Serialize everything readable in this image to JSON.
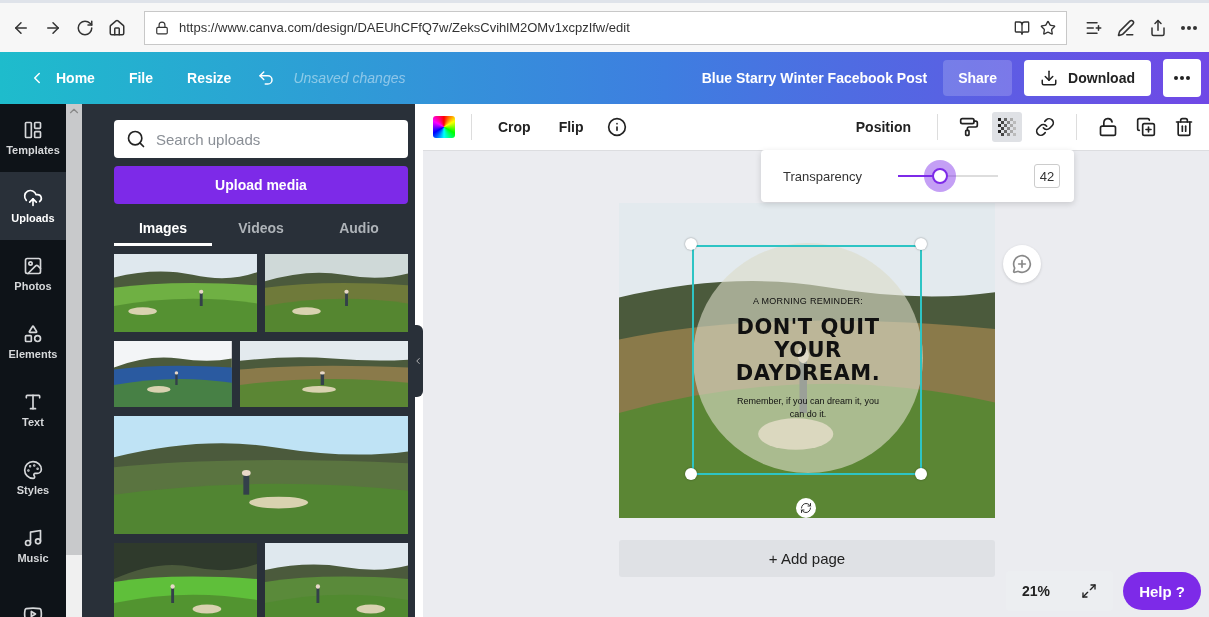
{
  "browser": {
    "url": "https://www.canva.com/design/DAEUhCFfQ7w/ZeksCvihlM2OMv1xcpzIfw/edit"
  },
  "topbar": {
    "home": "Home",
    "file": "File",
    "resize": "Resize",
    "status": "Unsaved changes",
    "title": "Blue Starry Winter Facebook Post",
    "share": "Share",
    "download": "Download"
  },
  "sidebar": {
    "items": [
      {
        "kind": "templates",
        "label": "Templates",
        "selected": false
      },
      {
        "kind": "uploads",
        "label": "Uploads",
        "selected": true
      },
      {
        "kind": "photos",
        "label": "Photos",
        "selected": false
      },
      {
        "kind": "elements",
        "label": "Elements",
        "selected": false
      },
      {
        "kind": "text",
        "label": "Text",
        "selected": false
      },
      {
        "kind": "styles",
        "label": "Styles",
        "selected": false
      },
      {
        "kind": "music",
        "label": "Music",
        "selected": false
      },
      {
        "kind": "videos",
        "selected": false
      }
    ]
  },
  "panel": {
    "search": {
      "placeholder": "Search uploads"
    },
    "upload_button": "Upload media",
    "tabs": [
      {
        "label": "Images",
        "selected": true
      },
      {
        "label": "Videos",
        "selected": false
      },
      {
        "label": "Audio",
        "selected": false
      }
    ]
  },
  "toolbar": {
    "crop": "Crop",
    "flip": "Flip",
    "position": "Position",
    "transparency_on": true
  },
  "transparency": {
    "label": "Transparency",
    "level": 0.42,
    "value": "42"
  },
  "design": {
    "kicker": "A MORNING REMINDER:",
    "headline": "DON'T QUIT YOUR DAYDREAM.",
    "body": "Remember, if you can dream it, you can do it."
  },
  "add_page": "+ Add page",
  "zoom": "21%",
  "help": "Help ?"
}
